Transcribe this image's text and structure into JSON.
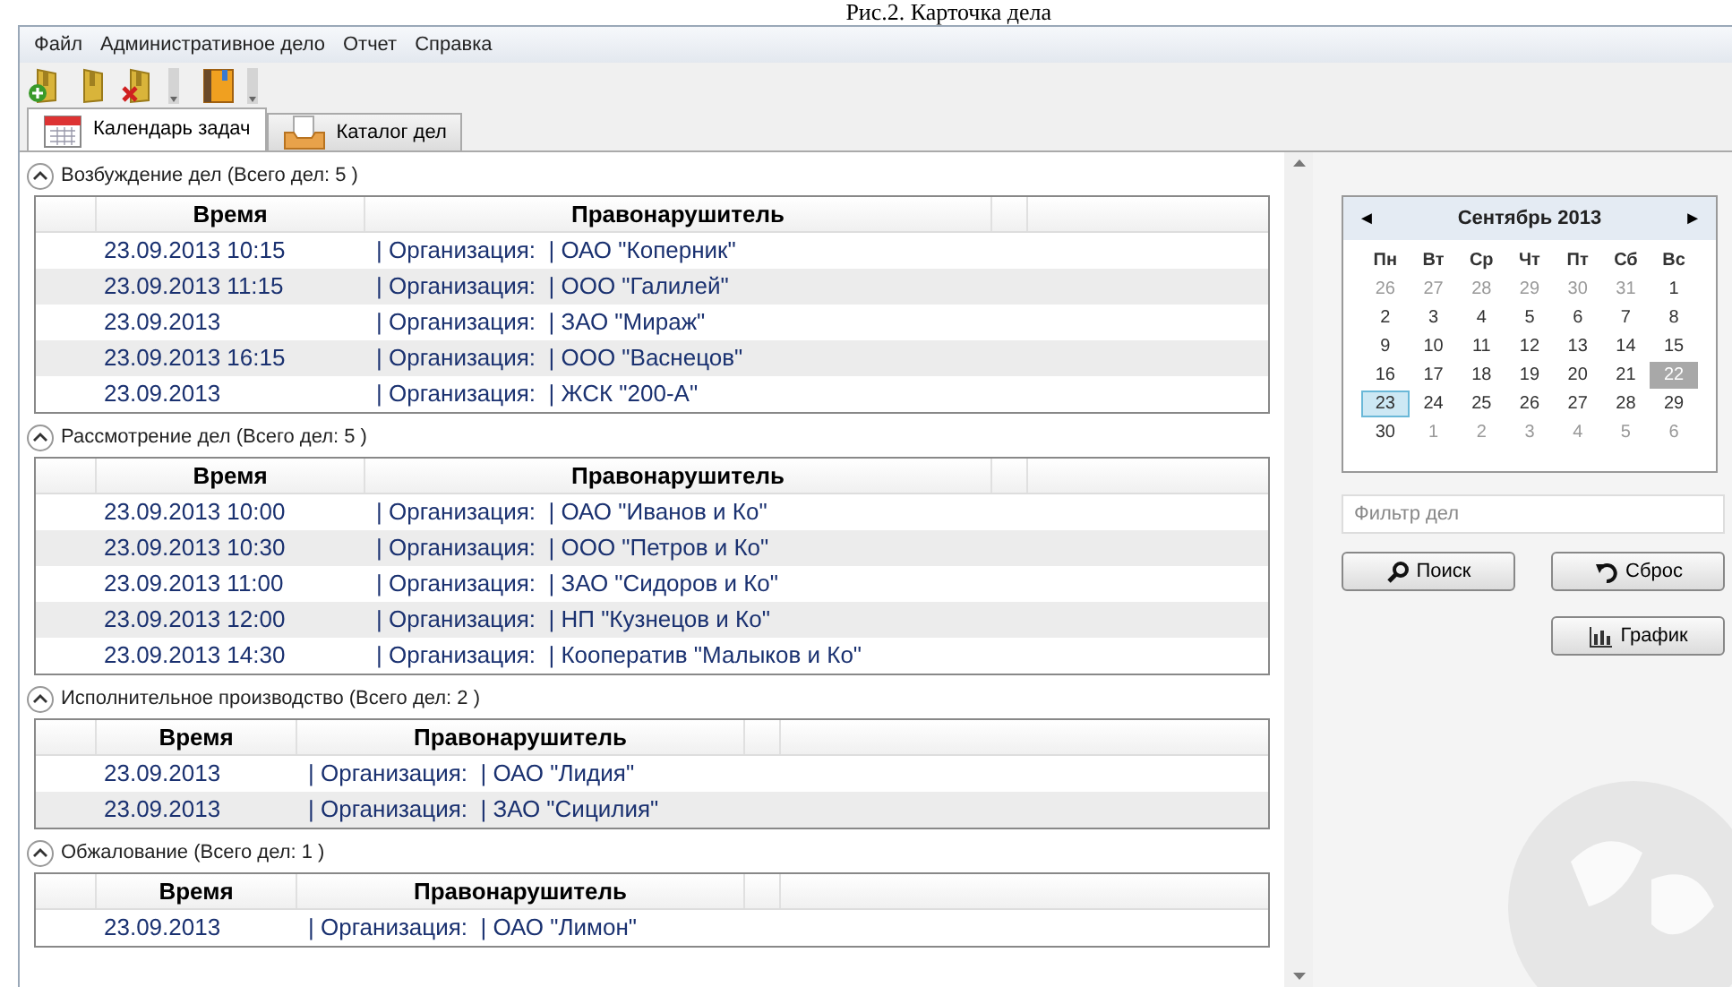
{
  "caption": "Рис.2. Карточка дела",
  "menu": [
    "Файл",
    "Административное дело",
    "Отчет",
    "Справка"
  ],
  "tabs": [
    {
      "label": "Календарь задач",
      "selected": true,
      "kind": "calendar"
    },
    {
      "label": "Каталог дел",
      "selected": false,
      "kind": "catalog"
    }
  ],
  "groups": [
    {
      "title": "Возбуждение дел (Всего дел: 5 )",
      "expanded": true,
      "columns": [
        "Время",
        "Правонарушитель"
      ],
      "rows": [
        {
          "time": "23.09.2013 10:15",
          "offender": "| Организация:  | ОАО \"Коперник\""
        },
        {
          "time": "23.09.2013 11:15",
          "offender": "| Организация:  | ООО \"Галилей\""
        },
        {
          "time": "23.09.2013",
          "offender": "| Организация:  | ЗАО \"Мираж\""
        },
        {
          "time": "23.09.2013 16:15",
          "offender": "| Организация:  | ООО \"Васнецов\""
        },
        {
          "time": "23.09.2013",
          "offender": "| Организация:  | ЖСК \"200-А\""
        }
      ]
    },
    {
      "title": "Рассмотрение дел (Всего дел: 5 )",
      "expanded": true,
      "columns": [
        "Время",
        "Правонарушитель"
      ],
      "rows": [
        {
          "time": "23.09.2013 10:00",
          "offender": "| Организация:  | ОАО \"Иванов и Ко\""
        },
        {
          "time": "23.09.2013 10:30",
          "offender": "| Организация:  | ООО \"Петров и Ко\""
        },
        {
          "time": "23.09.2013 11:00",
          "offender": "| Организация:  | ЗАО \"Сидоров и Ко\""
        },
        {
          "time": "23.09.2013 12:00",
          "offender": "| Организация:  | НП \"Кузнецов и Ко\""
        },
        {
          "time": "23.09.2013 14:30",
          "offender": "| Организация:  | Кооператив \"Малыков и Ко\""
        }
      ]
    },
    {
      "title": "Исполнительное производство (Всего дел: 2 )",
      "expanded": true,
      "columns": [
        "Время",
        "Правонарушитель"
      ],
      "rows": [
        {
          "time": "23.09.2013",
          "offender": "| Организация:  | ОАО \"Лидия\""
        },
        {
          "time": "23.09.2013",
          "offender": "| Организация:  | ЗАО \"Сицилия\""
        }
      ]
    },
    {
      "title": "Обжалование (Всего дел: 1 )",
      "expanded": true,
      "columns": [
        "Время",
        "Правонарушитель"
      ],
      "rows": [
        {
          "time": "23.09.2013",
          "offender": "| Организация:  | ОАО \"Лимон\""
        }
      ]
    }
  ],
  "calendar": {
    "prev": "◄",
    "month": "Сентябрь 2013",
    "next": "►",
    "weekdays": [
      "Пн",
      "Вт",
      "Ср",
      "Чт",
      "Пт",
      "Сб",
      "Вс"
    ],
    "weeks": [
      [
        {
          "d": "26",
          "other_month": true,
          "today": false,
          "selected": false
        },
        {
          "d": "27",
          "other_month": true,
          "today": false,
          "selected": false
        },
        {
          "d": "28",
          "other_month": true,
          "today": false,
          "selected": false
        },
        {
          "d": "29",
          "other_month": true,
          "today": false,
          "selected": false
        },
        {
          "d": "30",
          "other_month": true,
          "today": false,
          "selected": false
        },
        {
          "d": "31",
          "other_month": true,
          "today": false,
          "selected": false
        },
        {
          "d": "1",
          "other_month": false,
          "today": false,
          "selected": false
        }
      ],
      [
        {
          "d": "2",
          "other_month": false,
          "today": false,
          "selected": false
        },
        {
          "d": "3",
          "other_month": false,
          "today": false,
          "selected": false
        },
        {
          "d": "4",
          "other_month": false,
          "today": false,
          "selected": false
        },
        {
          "d": "5",
          "other_month": false,
          "today": false,
          "selected": false
        },
        {
          "d": "6",
          "other_month": false,
          "today": false,
          "selected": false
        },
        {
          "d": "7",
          "other_month": false,
          "today": false,
          "selected": false
        },
        {
          "d": "8",
          "other_month": false,
          "today": false,
          "selected": false
        }
      ],
      [
        {
          "d": "9",
          "other_month": false,
          "today": false,
          "selected": false
        },
        {
          "d": "10",
          "other_month": false,
          "today": false,
          "selected": false
        },
        {
          "d": "11",
          "other_month": false,
          "today": false,
          "selected": false
        },
        {
          "d": "12",
          "other_month": false,
          "today": false,
          "selected": false
        },
        {
          "d": "13",
          "other_month": false,
          "today": false,
          "selected": false
        },
        {
          "d": "14",
          "other_month": false,
          "today": false,
          "selected": false
        },
        {
          "d": "15",
          "other_month": false,
          "today": false,
          "selected": false
        }
      ],
      [
        {
          "d": "16",
          "other_month": false,
          "today": false,
          "selected": false
        },
        {
          "d": "17",
          "other_month": false,
          "today": false,
          "selected": false
        },
        {
          "d": "18",
          "other_month": false,
          "today": false,
          "selected": false
        },
        {
          "d": "19",
          "other_month": false,
          "today": false,
          "selected": false
        },
        {
          "d": "20",
          "other_month": false,
          "today": false,
          "selected": false
        },
        {
          "d": "21",
          "other_month": false,
          "today": false,
          "selected": false
        },
        {
          "d": "22",
          "other_month": false,
          "today": true,
          "selected": false
        }
      ],
      [
        {
          "d": "23",
          "other_month": false,
          "today": false,
          "selected": true
        },
        {
          "d": "24",
          "other_month": false,
          "today": false,
          "selected": false
        },
        {
          "d": "25",
          "other_month": false,
          "today": false,
          "selected": false
        },
        {
          "d": "26",
          "other_month": false,
          "today": false,
          "selected": false
        },
        {
          "d": "27",
          "other_month": false,
          "today": false,
          "selected": false
        },
        {
          "d": "28",
          "other_month": false,
          "today": false,
          "selected": false
        },
        {
          "d": "29",
          "other_month": false,
          "today": false,
          "selected": false
        }
      ],
      [
        {
          "d": "30",
          "other_month": false,
          "today": false,
          "selected": false
        },
        {
          "d": "1",
          "other_month": true,
          "today": false,
          "selected": false
        },
        {
          "d": "2",
          "other_month": true,
          "today": false,
          "selected": false
        },
        {
          "d": "3",
          "other_month": true,
          "today": false,
          "selected": false
        },
        {
          "d": "4",
          "other_month": true,
          "today": false,
          "selected": false
        },
        {
          "d": "5",
          "other_month": true,
          "today": false,
          "selected": false
        },
        {
          "d": "6",
          "other_month": true,
          "today": false,
          "selected": false
        }
      ]
    ]
  },
  "filter": {
    "placeholder": "Фильтр дел"
  },
  "buttons": [
    {
      "label": "Поиск",
      "kind": "search"
    },
    {
      "label": "Сброс",
      "kind": "reset"
    },
    {
      "label": "График",
      "kind": "chart"
    }
  ]
}
